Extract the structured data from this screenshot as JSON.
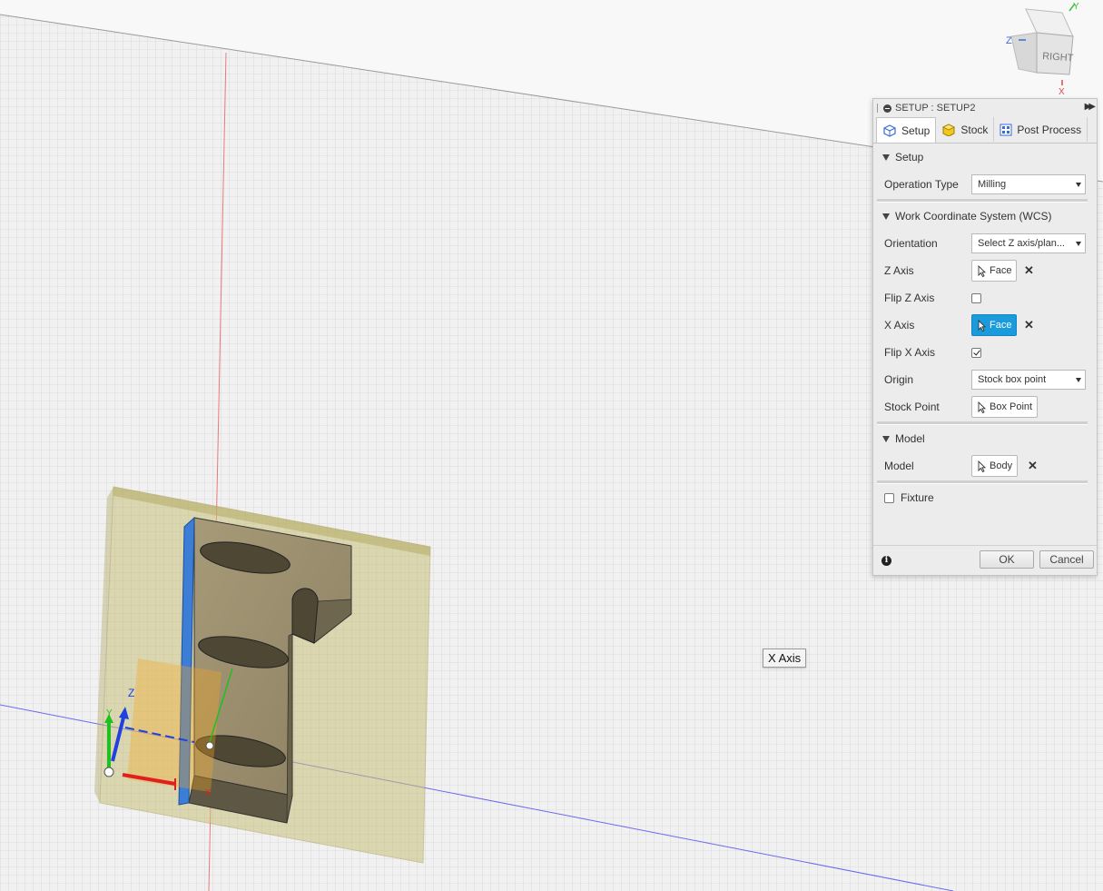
{
  "viewcube": {
    "face_label": "RIGHT",
    "axis_x": "X",
    "axis_y": "Y",
    "axis_z": "Z"
  },
  "triad": {
    "label_x": "X",
    "label_y": "Y",
    "label_z": "Z"
  },
  "tooltip": {
    "text": "X Axis"
  },
  "panel": {
    "title": "SETUP : SETUP2",
    "tabs": [
      {
        "label": "Setup",
        "icon": "setup-icon",
        "active": true
      },
      {
        "label": "Stock",
        "icon": "stock-cube-icon",
        "active": false
      },
      {
        "label": "Post Process",
        "icon": "post-process-icon",
        "active": false
      }
    ],
    "setup": {
      "header": "Setup",
      "operation_type_label": "Operation Type",
      "operation_type_value": "Milling"
    },
    "wcs": {
      "header": "Work Coordinate System (WCS)",
      "orientation_label": "Orientation",
      "orientation_value": "Select Z axis/plan...",
      "z_axis_label": "Z Axis",
      "z_axis_value": "Face",
      "flip_z_label": "Flip Z Axis",
      "flip_z_checked": false,
      "x_axis_label": "X Axis",
      "x_axis_value": "Face",
      "flip_x_label": "Flip X Axis",
      "flip_x_checked": true,
      "origin_label": "Origin",
      "origin_value": "Stock box point",
      "stock_point_label": "Stock Point",
      "stock_point_value": "Box Point"
    },
    "model": {
      "header": "Model",
      "model_label": "Model",
      "model_value": "Body"
    },
    "fixture": {
      "label": "Fixture",
      "checked": false
    },
    "buttons": {
      "ok": "OK",
      "cancel": "Cancel"
    }
  },
  "colors": {
    "accent": "#1a9bdc",
    "x_axis": "#e02020",
    "y_axis": "#20c020",
    "z_axis": "#2040e0"
  }
}
